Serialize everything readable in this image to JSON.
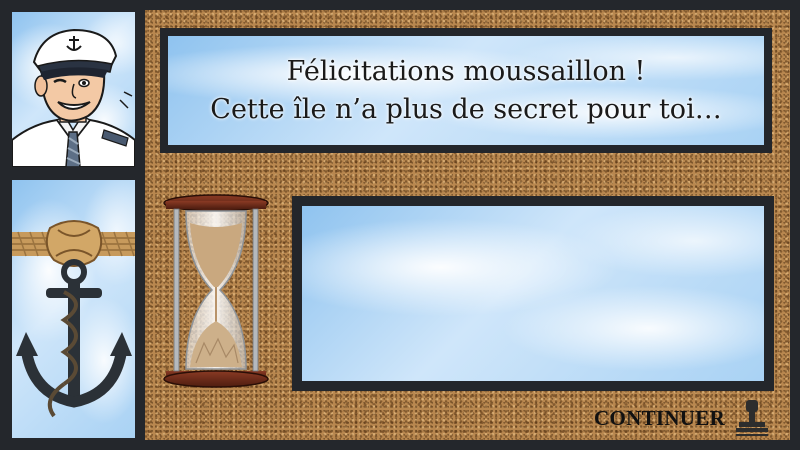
{
  "message": {
    "line1": "Félicitations moussaillon !",
    "line2": "Cette île n’a plus de secret pour toi…"
  },
  "answer_box": {
    "text": ""
  },
  "continue_button": {
    "label": "CONTINUER"
  },
  "icons": {
    "portrait": "sailor-captain-icon",
    "anchor": "anchor-rope-icon",
    "timer": "hourglass-icon",
    "continue": "stamp-icon"
  },
  "colors": {
    "frame": "#23262b",
    "cork": "#b8874f",
    "sky": "#a9d2f4"
  }
}
